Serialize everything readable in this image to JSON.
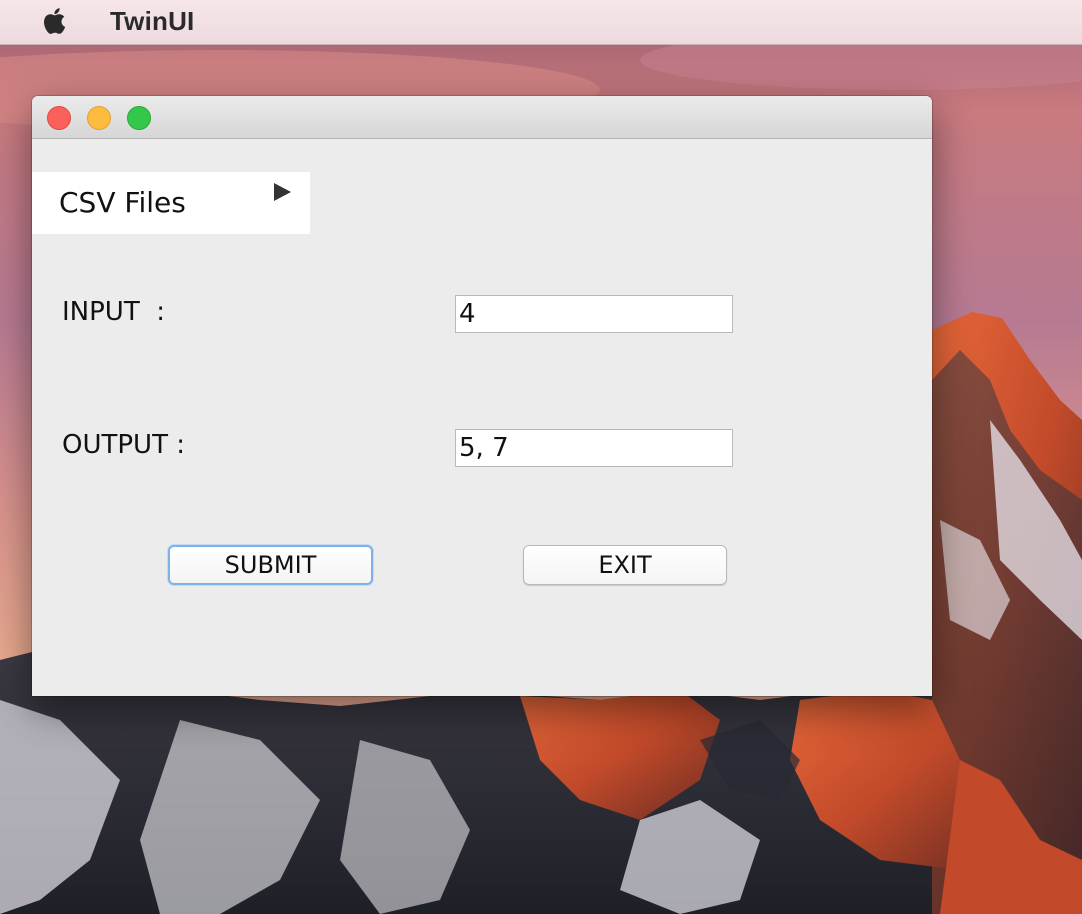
{
  "menubar": {
    "app_name": "TwinUI",
    "apple_icon": "apple-logo-icon"
  },
  "window": {
    "traffic_lights": [
      "close",
      "minimize",
      "zoom"
    ]
  },
  "menu": {
    "label": "CSV Files",
    "arrow_icon": "play-arrow-icon"
  },
  "form": {
    "input_label": "INPUT  :",
    "input_value": "4",
    "output_label": "OUTPUT :",
    "output_value": "5, 7"
  },
  "buttons": {
    "submit_label": "SUBMIT",
    "exit_label": "EXIT"
  },
  "colors": {
    "close": "#fc605b",
    "minimize": "#fdbc40",
    "zoom": "#34c84a",
    "focus_ring": "#7eb1e6"
  }
}
